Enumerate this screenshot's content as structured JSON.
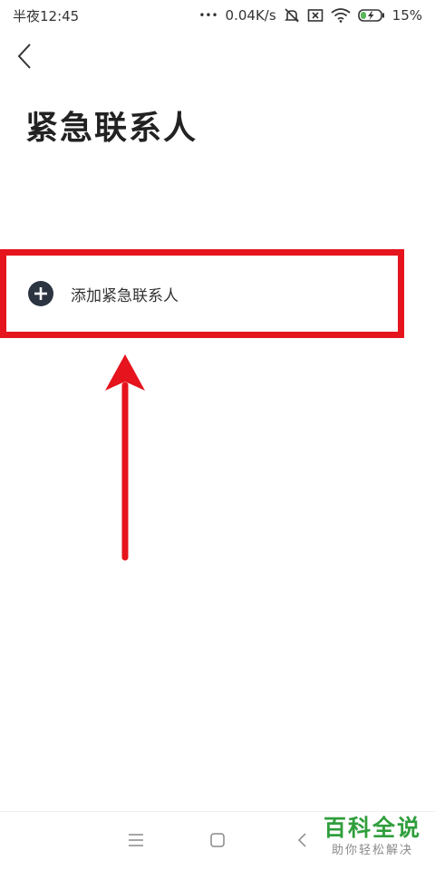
{
  "status_bar": {
    "time": "半夜12:45",
    "dots": "•••",
    "network_speed": "0.04K/s",
    "battery_percent": "15%",
    "icons": [
      "mute-icon",
      "sim-off-icon",
      "wifi-icon",
      "battery-charging-icon"
    ]
  },
  "header": {
    "back_icon": "chevron-left-icon",
    "title": "紧急联系人"
  },
  "main": {
    "add_contact_label": "添加紧急联系人",
    "add_icon": "plus-circle-icon"
  },
  "annotation": {
    "highlight_color": "#e5141d"
  },
  "nav_bar": {
    "icons": [
      "menu-icon",
      "home-square-icon",
      "back-triangle-icon"
    ]
  },
  "watermark": {
    "main": "百科全说",
    "sub": "助你轻松解决",
    "color": "#2f9e3c"
  }
}
